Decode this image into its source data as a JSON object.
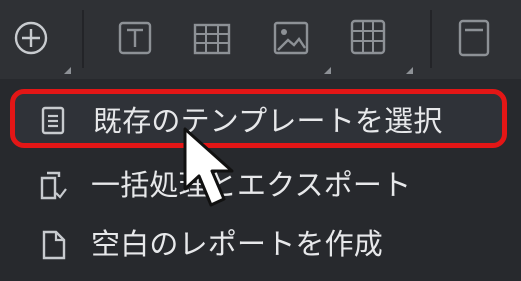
{
  "toolbar": {
    "buttons": [
      {
        "icon": "add-circle-icon",
        "has_dropdown": true
      },
      {
        "icon": "text-box-icon",
        "has_dropdown": false
      },
      {
        "icon": "table-icon",
        "has_dropdown": false
      },
      {
        "icon": "image-icon",
        "has_dropdown": true
      },
      {
        "icon": "grid-icon",
        "has_dropdown": true
      },
      {
        "icon": "panel-icon",
        "has_dropdown": false
      }
    ]
  },
  "menu": {
    "items": [
      {
        "label": "既存のテンプレートを選択",
        "icon": "template-clipboard-icon",
        "highlighted": true
      },
      {
        "label": "一括処理とエクスポート",
        "icon": "batch-copy-icon",
        "highlighted": false
      },
      {
        "label": "空白のレポートを作成",
        "icon": "blank-document-icon",
        "highlighted": false
      }
    ]
  },
  "colors": {
    "toolbar_bg": "#2f3135",
    "menu_bg": "#27292d",
    "highlight_border": "#e31616",
    "text": "#e7e8ea",
    "icon": "#c8cbcf"
  }
}
